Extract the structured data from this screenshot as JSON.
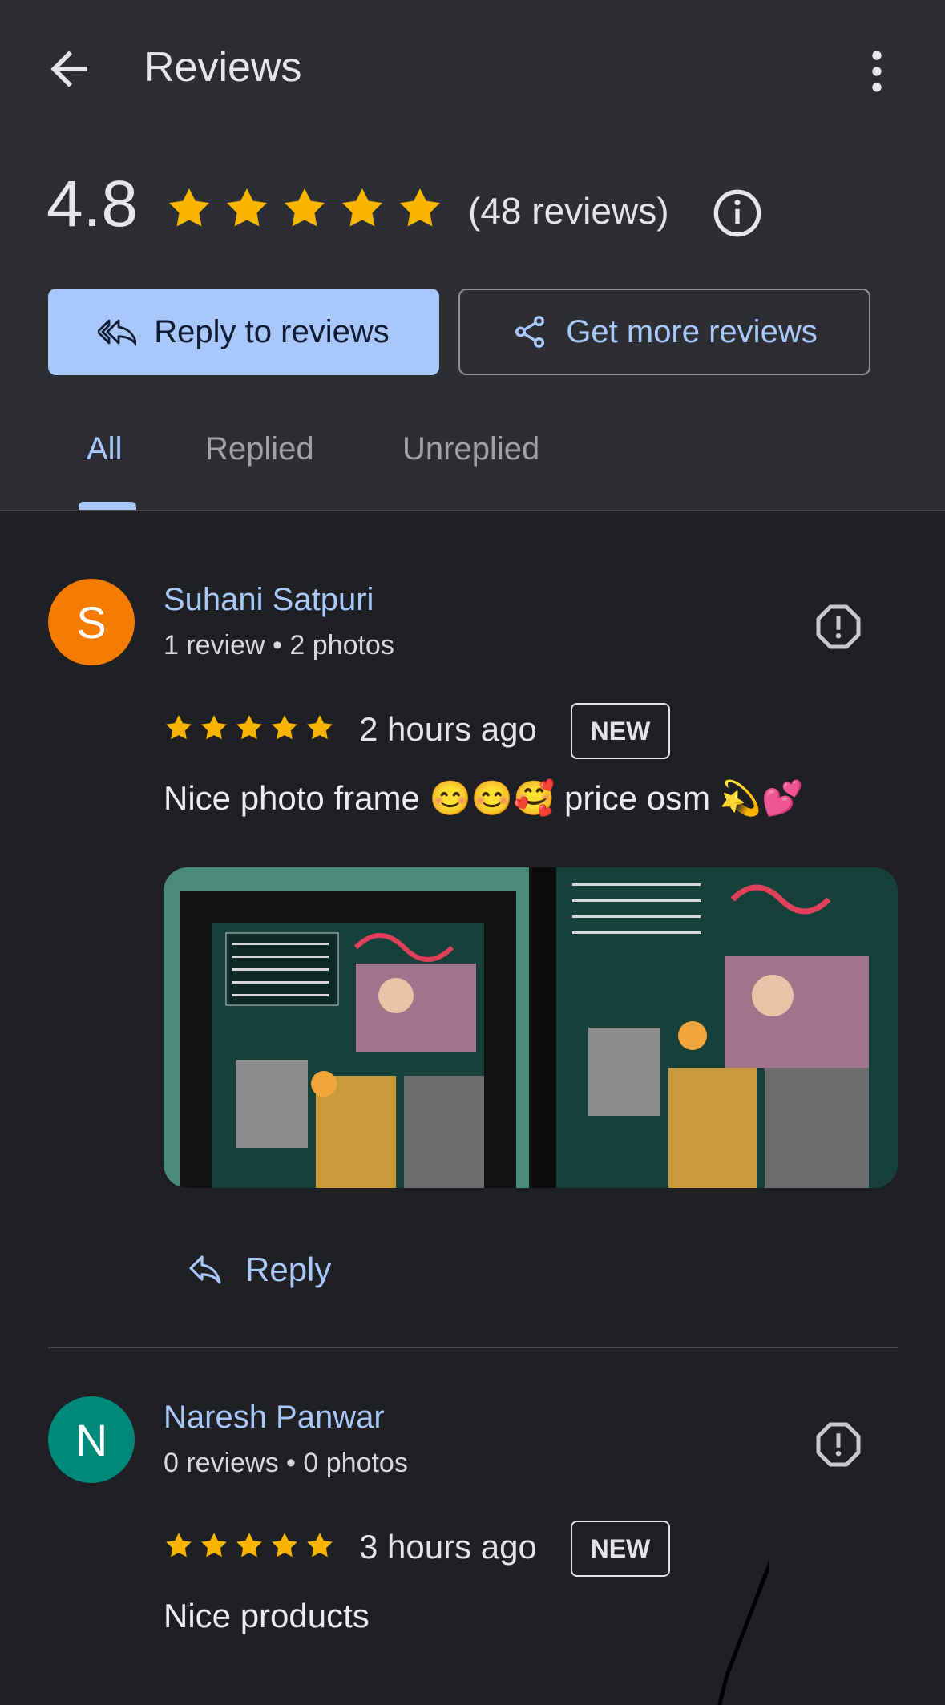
{
  "header": {
    "title": "Reviews"
  },
  "summary": {
    "rating": "4.8",
    "stars": 5,
    "count_text": "(48 reviews)"
  },
  "actions": {
    "reply_label": "Reply to reviews",
    "more_label": "Get more reviews"
  },
  "tabs": [
    {
      "label": "All",
      "active": true
    },
    {
      "label": "Replied",
      "active": false
    },
    {
      "label": "Unreplied",
      "active": false
    }
  ],
  "reviews": [
    {
      "initial": "S",
      "avatar_color": "#f57c00",
      "name": "Suhani Satpuri",
      "meta": "1 review • 2 photos",
      "stars": 5,
      "time": "2 hours ago",
      "badge": "NEW",
      "text": "Nice photo frame 😊😊🥰 price osm 💫💕",
      "reply_label": "Reply"
    },
    {
      "initial": "N",
      "avatar_color": "#00897b",
      "name": "Naresh Panwar",
      "meta": "0 reviews • 0 photos",
      "stars": 5,
      "time": "3 hours ago",
      "badge": "NEW",
      "text": "Nice products"
    }
  ],
  "colors": {
    "accent": "#a8c7fa",
    "star": "#f9b400",
    "background": "#1f2024",
    "header_bg": "#2d2e33"
  }
}
